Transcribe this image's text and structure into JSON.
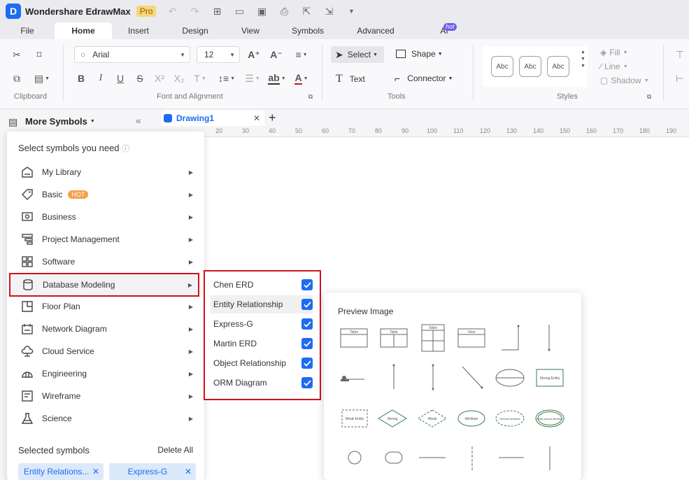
{
  "app": {
    "title": "Wondershare EdrawMax",
    "logo_letter": "D",
    "edition": "Pro"
  },
  "menu": {
    "tabs": [
      "File",
      "Home",
      "Insert",
      "Design",
      "View",
      "Symbols",
      "Advanced",
      "AI"
    ],
    "active": "Home",
    "ai_badge": "hot"
  },
  "ribbon": {
    "groups": {
      "clipboard": "Clipboard",
      "font": "Font and Alignment",
      "tools": "Tools",
      "styles": "Styles"
    },
    "font_name": "Arial",
    "font_size": "12",
    "select_label": "Select",
    "shape_label": "Shape",
    "text_label": "Text",
    "connector_label": "Connector",
    "style_samples": [
      "Abc",
      "Abc",
      "Abc"
    ],
    "fill_label": "Fill",
    "line_label": "Line",
    "shadow_label": "Shadow"
  },
  "panel": {
    "title": "More Symbols"
  },
  "document": {
    "tab_name": "Drawing1"
  },
  "ruler": {
    "ticks": [
      "20",
      "30",
      "40",
      "50",
      "60",
      "70",
      "80",
      "90",
      "100",
      "110",
      "120",
      "130",
      "140",
      "150",
      "160",
      "170",
      "180",
      "190"
    ]
  },
  "symbols_menu": {
    "title": "Select symbols you need",
    "categories": [
      {
        "label": "My Library",
        "icon": "library-icon"
      },
      {
        "label": "Basic",
        "icon": "tag-icon",
        "badge": "HOT"
      },
      {
        "label": "Business",
        "icon": "business-icon"
      },
      {
        "label": "Project Management",
        "icon": "project-icon"
      },
      {
        "label": "Software",
        "icon": "software-icon"
      },
      {
        "label": "Database Modeling",
        "icon": "database-icon",
        "selected": true
      },
      {
        "label": "Floor Plan",
        "icon": "floorplan-icon"
      },
      {
        "label": "Network Diagram",
        "icon": "network-icon"
      },
      {
        "label": "Cloud Service",
        "icon": "cloud-icon"
      },
      {
        "label": "Engineering",
        "icon": "engineering-icon"
      },
      {
        "label": "Wireframe",
        "icon": "wireframe-icon"
      },
      {
        "label": "Science",
        "icon": "science-icon"
      }
    ],
    "selected_label": "Selected symbols",
    "delete_all": "Delete All",
    "selected_chips": [
      "Entity Relations...",
      "Express-G"
    ]
  },
  "submenu": {
    "items": [
      {
        "label": "Chen ERD",
        "checked": true
      },
      {
        "label": "Entity Relationship",
        "checked": true
      },
      {
        "label": "Express-G",
        "checked": true
      },
      {
        "label": "Martin ERD",
        "checked": true
      },
      {
        "label": "Object Relationship",
        "checked": true
      },
      {
        "label": "ORM Diagram",
        "checked": true
      }
    ]
  },
  "preview": {
    "title": "Preview Image",
    "labels": {
      "table1": "Table",
      "table2": "Table",
      "table3": "Table",
      "view": "View",
      "strong_entity": "Strong Entity",
      "weak_entity": "Weak Entity",
      "strong_rel": "Strong",
      "weak_rel": "Weak",
      "attribute": "Attribute",
      "derived": "Derived attribute",
      "multivalued": "Multi-valued attribute"
    }
  },
  "colors": {
    "accent": "#1e6cf0",
    "highlight_border": "#d0121b",
    "hot": "#f7a04a"
  }
}
